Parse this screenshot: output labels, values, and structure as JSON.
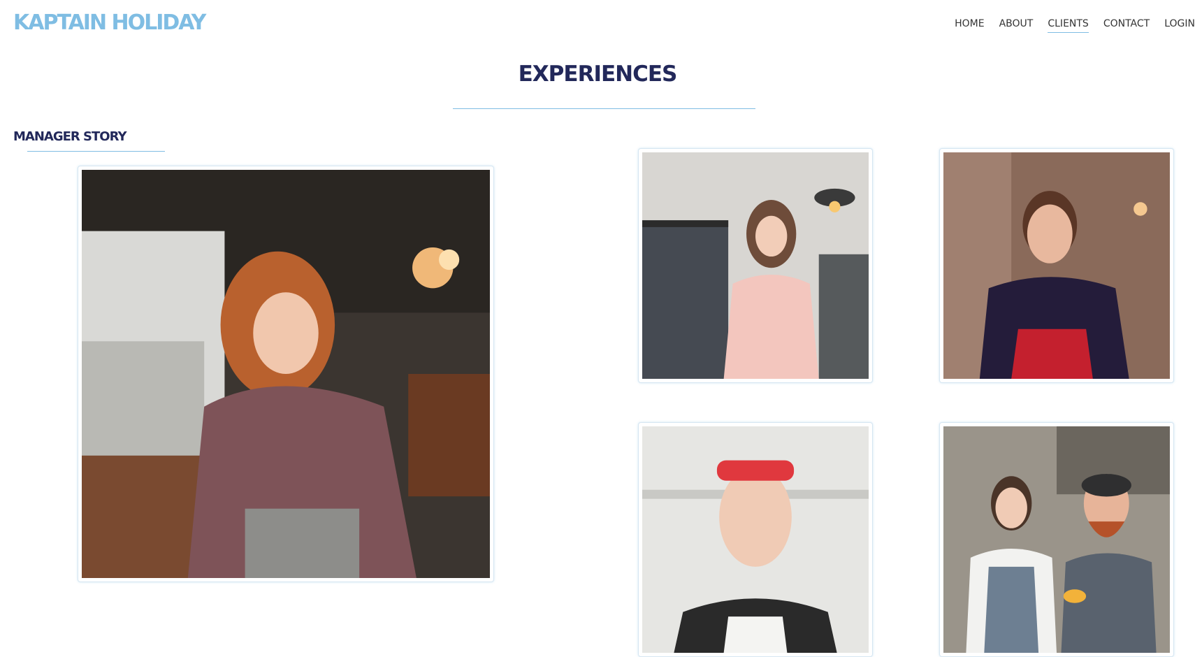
{
  "header": {
    "logo_text": "KAPTAIN HOLIDAY",
    "nav": [
      {
        "label": "HOME",
        "active": false
      },
      {
        "label": "ABOUT",
        "active": false
      },
      {
        "label": "CLIENTS",
        "active": true
      },
      {
        "label": "CONTACT",
        "active": false
      },
      {
        "label": "LOGIN",
        "active": false
      }
    ]
  },
  "main": {
    "title": "EXPERIENCES",
    "section_heading": "MANAGER STORY",
    "photos": [
      {
        "name": "manager-photo",
        "subject": "woman with red hair smiling at laptop in cafe"
      },
      {
        "name": "client-photo-1",
        "subject": "young woman in pink top in clothing store"
      },
      {
        "name": "client-photo-2",
        "subject": "smiling man in dark t-shirt and red apron"
      },
      {
        "name": "client-photo-3",
        "subject": "woman with red headband in cafe apron"
      },
      {
        "name": "client-photo-4",
        "subject": "two baristas in aprons holding coffee cup"
      }
    ]
  },
  "colors": {
    "logo": "#7fbde3",
    "heading": "#22285a",
    "accent_line": "#7fbde3",
    "nav_text": "#333333"
  }
}
